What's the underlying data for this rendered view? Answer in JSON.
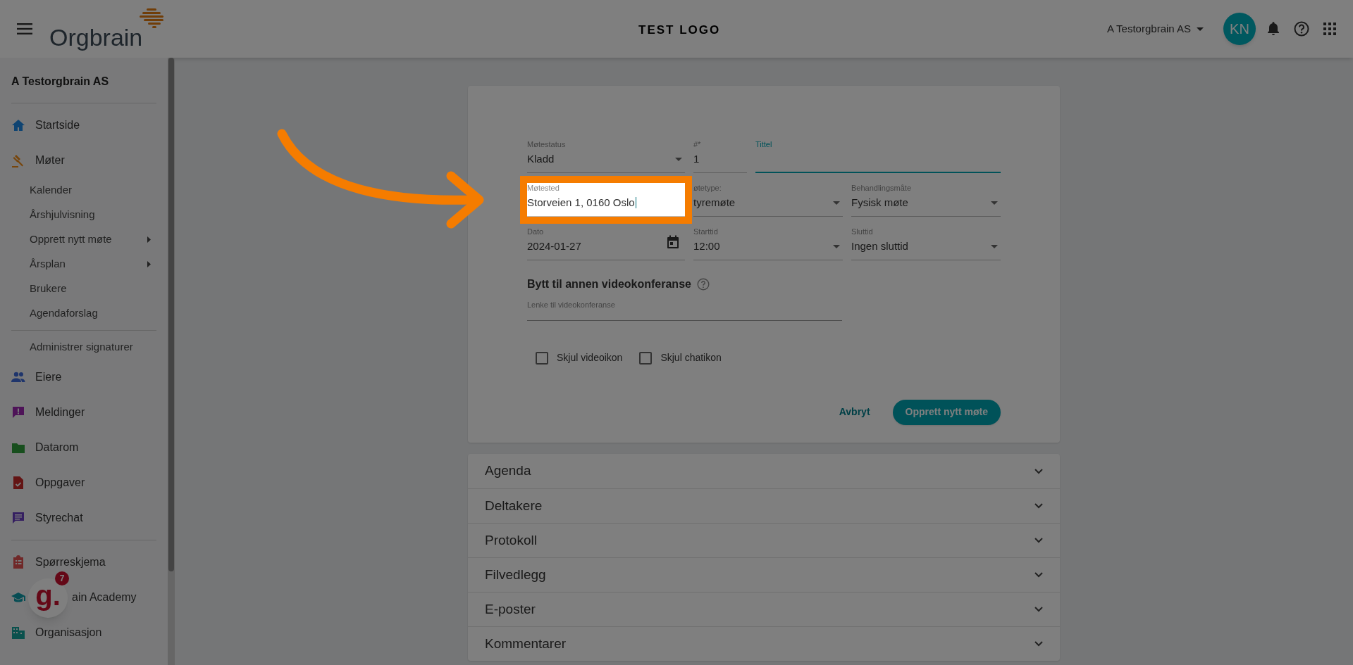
{
  "header": {
    "logo": "Orgbrain",
    "title": "TEST LOGO",
    "org_selector": "A Testorgbrain AS",
    "avatar": "KN"
  },
  "sidebar": {
    "org_name": "A Testorgbrain AS",
    "items": [
      {
        "kind": "divider"
      },
      {
        "kind": "main",
        "label": "Startside"
      },
      {
        "kind": "main",
        "label": "Møter"
      },
      {
        "kind": "sub",
        "label": "Kalender",
        "has_submenu": false
      },
      {
        "kind": "sub",
        "label": "Årshjulvisning",
        "has_submenu": false
      },
      {
        "kind": "sub",
        "label": "Opprett nytt møte",
        "has_submenu": true
      },
      {
        "kind": "sub",
        "label": "Årsplan",
        "has_submenu": true
      },
      {
        "kind": "sub",
        "label": "Brukere",
        "has_submenu": false
      },
      {
        "kind": "sub",
        "label": "Agendaforslag",
        "has_submenu": false
      },
      {
        "kind": "divider"
      },
      {
        "kind": "sub",
        "label": "Administrer signaturer",
        "has_submenu": false
      },
      {
        "kind": "main",
        "label": "Eiere"
      },
      {
        "kind": "main",
        "label": "Meldinger"
      },
      {
        "kind": "main",
        "label": "Datarom"
      },
      {
        "kind": "main",
        "label": "Oppgaver"
      },
      {
        "kind": "main",
        "label": "Styrechat"
      },
      {
        "kind": "divider"
      },
      {
        "kind": "main",
        "label": "Spørreskjema"
      },
      {
        "kind": "main",
        "label": "ain Academy",
        "covered": true
      },
      {
        "kind": "main",
        "label": "Organisasjon"
      }
    ]
  },
  "form": {
    "rows": [
      [
        {
          "kind": "select",
          "label": "Møtestatus",
          "value": "Kladd",
          "focused": false,
          "highlighted": false
        },
        {
          "kind": "text",
          "label": "#*",
          "value": "1",
          "focused": false,
          "highlighted": false
        },
        {
          "kind": "text",
          "label": "Tittel",
          "focused": true,
          "highlighted": false
        }
      ],
      [
        {
          "kind": "text",
          "label": "Møtested",
          "value": "Storveien 1, 0160 Oslo",
          "focused": false,
          "highlighted": true
        },
        {
          "kind": "select",
          "label": "øtetype:",
          "value": "tyremøte",
          "focused": false,
          "highlighted": false
        },
        {
          "kind": "select",
          "label": "Behandlingsmåte",
          "value": "Fysisk møte",
          "focused": false,
          "highlighted": false
        }
      ],
      [
        {
          "kind": "date",
          "label": "Dato",
          "value": "2024-01-27",
          "focused": false,
          "highlighted": false
        },
        {
          "kind": "select",
          "label": "Starttid",
          "value": "12:00",
          "focused": false,
          "highlighted": false
        },
        {
          "kind": "select",
          "label": "Sluttid",
          "value": "Ingen sluttid",
          "focused": false,
          "highlighted": false
        }
      ]
    ],
    "video_heading": "Bytt til annen videokonferanse",
    "video_link": {
      "label": "Lenke til videokonferanse"
    },
    "checkboxes": [
      {
        "label": "Skjul videoikon",
        "checked": false
      },
      {
        "label": "Skjul chatikon",
        "checked": false
      }
    ],
    "cancel_button": "Avbryt",
    "submit_button": "Opprett nytt møte"
  },
  "sections": [
    {
      "label": "Agenda",
      "expanded": false
    },
    {
      "label": "Deltakere",
      "expanded": false
    },
    {
      "label": "Protokoll",
      "expanded": false
    },
    {
      "label": "Filvedlegg",
      "expanded": false
    },
    {
      "label": "E-poster",
      "expanded": false
    },
    {
      "label": "Kommentarer",
      "expanded": false
    }
  ],
  "chat_widget": {
    "logo": "g.",
    "badge": "7"
  }
}
